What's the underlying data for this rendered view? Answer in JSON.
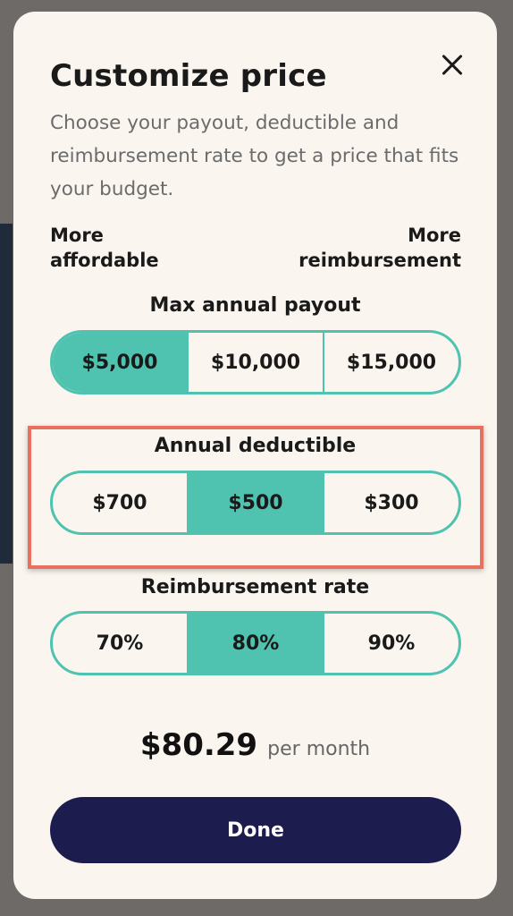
{
  "modal": {
    "title": "Customize price",
    "subtitle": "Choose your payout, deductible and reimbursement rate to get a price that fits your budget.",
    "scale_left": [
      "More",
      "affordable"
    ],
    "scale_right": [
      "More",
      "reimbursement"
    ]
  },
  "payout": {
    "label": "Max annual payout",
    "options": [
      "$5,000",
      "$10,000",
      "$15,000"
    ],
    "selected": "$5,000"
  },
  "deductible": {
    "label": "Annual deductible",
    "options": [
      "$700",
      "$500",
      "$300"
    ],
    "selected": "$500"
  },
  "reimbursement": {
    "label": "Reimbursement rate",
    "options": [
      "70%",
      "80%",
      "90%"
    ],
    "selected": "80%"
  },
  "price": {
    "amount": "$80.29",
    "unit": "per month"
  },
  "done_label": "Done",
  "colors": {
    "accent": "#4fc3b0",
    "highlight": "#e8705e",
    "primary_button": "#1c1c4f",
    "modal_bg": "#faf6ef"
  }
}
